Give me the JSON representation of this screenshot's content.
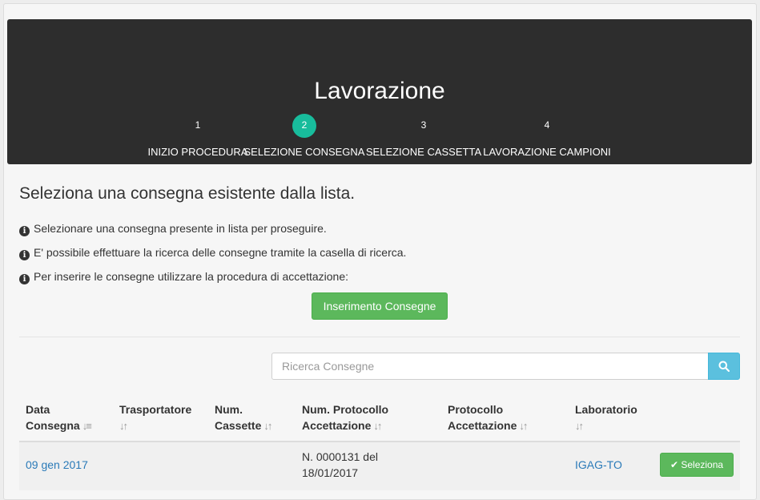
{
  "header": {
    "title": "Lavorazione",
    "steps": [
      {
        "num": "1",
        "label": "INIZIO PROCEDURA"
      },
      {
        "num": "2",
        "label": "SELEZIONE CONSEGNA"
      },
      {
        "num": "3",
        "label": "SELEZIONE CASSETTA"
      },
      {
        "num": "4",
        "label": "LAVORAZIONE CAMPIONI"
      }
    ],
    "active_step": 2
  },
  "content": {
    "heading": "Seleziona una consegna esistente dalla lista.",
    "info": [
      "Selezionare una consegna presente in lista per proseguire.",
      "E' possibile effettuare la ricerca delle consegne tramite la casella di ricerca.",
      "Per inserire le consegne utilizzare la procedura di accettazione:"
    ],
    "insert_button": "Inserimento Consegne"
  },
  "search": {
    "placeholder": "Ricerca Consegne",
    "icon": "search-icon"
  },
  "table": {
    "columns": [
      {
        "line1": "Data",
        "line2": "Consegna"
      },
      {
        "line1": "Trasportatore",
        "line2": ""
      },
      {
        "line1": "Num.",
        "line2": "Cassette"
      },
      {
        "line1": "Num. Protocollo",
        "line2": "Accettazione"
      },
      {
        "line1": "Protocollo",
        "line2": "Accettazione"
      },
      {
        "line1": "Laboratorio",
        "line2": ""
      }
    ],
    "rows": [
      {
        "data_consegna": "09 gen 2017",
        "trasportatore": "",
        "num_cassette": "",
        "num_protocollo_line1": "N. 0000131 del",
        "num_protocollo_line2": "18/01/2017",
        "protocollo": "",
        "laboratorio": "IGAG-TO",
        "action": "Seleziona"
      }
    ]
  },
  "colors": {
    "header_bg": "#2d2d2d",
    "step_active": "#18bc9c",
    "success": "#5cb85c",
    "info": "#5bc0de",
    "link": "#2a7ab8"
  }
}
